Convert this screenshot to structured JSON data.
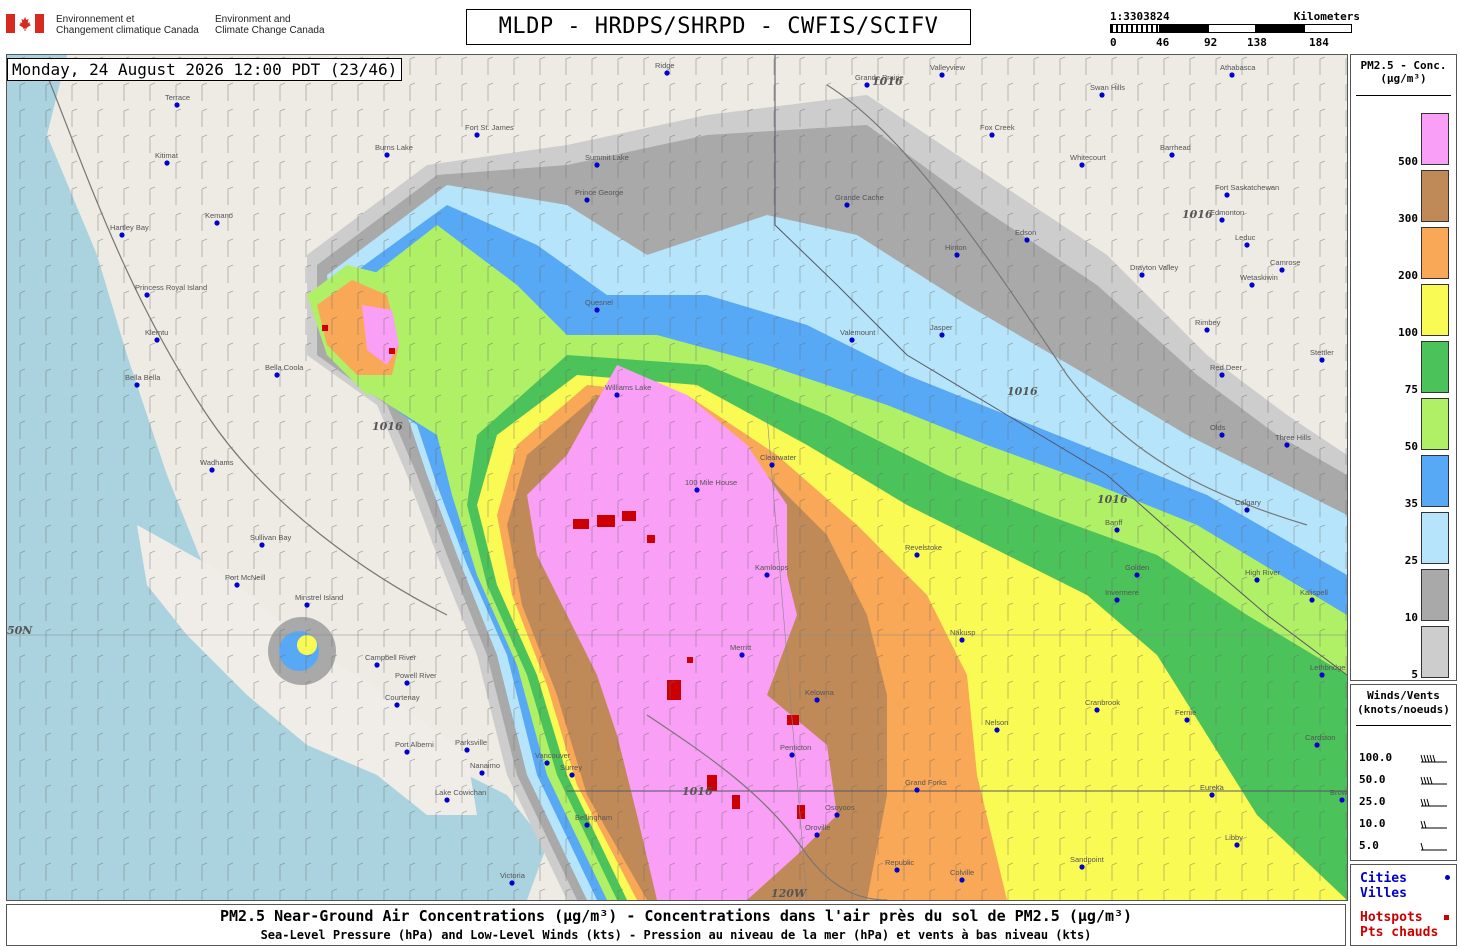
{
  "header": {
    "dept_fr": [
      "Environnement et",
      "Changement climatique Canada"
    ],
    "dept_en": [
      "Environment and",
      "Climate Change Canada"
    ],
    "title": "MLDP - HRDPS/SHRPD - CWFIS/SCIFV"
  },
  "scale": {
    "ratio": "1:3303824",
    "unit": "Kilometers",
    "ticks": [
      "0",
      "46",
      "92",
      "138",
      "184"
    ]
  },
  "map": {
    "time_label": "Monday, 24 August 2026 12:00 PDT (23/46)",
    "isobar_label": "1016",
    "lat_label": "50N",
    "lon_label": "120W",
    "cities": [
      {
        "name": "Terrace"
      },
      {
        "name": "Kitimat"
      },
      {
        "name": "Hartley Bay"
      },
      {
        "name": "Kemano"
      },
      {
        "name": "Princess Royal Island"
      },
      {
        "name": "Klemtu"
      },
      {
        "name": "Bella Bella"
      },
      {
        "name": "Bella Coola"
      },
      {
        "name": "Wadhams"
      },
      {
        "name": "Sullivan Bay"
      },
      {
        "name": "Port McNeill"
      },
      {
        "name": "Minstrel Island"
      },
      {
        "name": "Campbell River"
      },
      {
        "name": "Powell River"
      },
      {
        "name": "Courtenay"
      },
      {
        "name": "Port Alberni"
      },
      {
        "name": "Parksville"
      },
      {
        "name": "Nanaimo"
      },
      {
        "name": "Lake Cowichan"
      },
      {
        "name": "Victoria"
      },
      {
        "name": "Vancouver"
      },
      {
        "name": "Surrey"
      },
      {
        "name": "Bellingham"
      },
      {
        "name": "Fort St. James"
      },
      {
        "name": "Burns Lake"
      },
      {
        "name": "Summit Lake"
      },
      {
        "name": "Prince George"
      },
      {
        "name": "Quesnel"
      },
      {
        "name": "Williams Lake"
      },
      {
        "name": "100 Mile House"
      },
      {
        "name": "Clearwater"
      },
      {
        "name": "Kamloops"
      },
      {
        "name": "Merritt"
      },
      {
        "name": "Kelowna"
      },
      {
        "name": "Penticton"
      },
      {
        "name": "Osoyoos"
      },
      {
        "name": "Grand Forks"
      },
      {
        "name": "Revelstoke"
      },
      {
        "name": "Nakusp"
      },
      {
        "name": "Nelson"
      },
      {
        "name": "Cranbrook"
      },
      {
        "name": "Fernie"
      },
      {
        "name": "Invermere"
      },
      {
        "name": "Golden"
      },
      {
        "name": "Banff"
      },
      {
        "name": "Calgary"
      },
      {
        "name": "High River"
      },
      {
        "name": "Red Deer"
      },
      {
        "name": "Edmonton"
      },
      {
        "name": "Leduc"
      },
      {
        "name": "Wetaskiwin"
      },
      {
        "name": "Camrose"
      },
      {
        "name": "Hinton"
      },
      {
        "name": "Edson"
      },
      {
        "name": "Jasper"
      },
      {
        "name": "Valemount"
      },
      {
        "name": "Grande Cache"
      },
      {
        "name": "Grande Prairie"
      },
      {
        "name": "Fox Creek"
      },
      {
        "name": "Whitecourt"
      },
      {
        "name": "Barrhead"
      },
      {
        "name": "Swan Hills"
      },
      {
        "name": "Drayton Valley"
      },
      {
        "name": "Rimbey"
      },
      {
        "name": "Olds"
      },
      {
        "name": "Three Hills"
      },
      {
        "name": "Stettler"
      },
      {
        "name": "Fort Saskatchewan"
      },
      {
        "name": "Athabasca"
      },
      {
        "name": "Valleyview"
      },
      {
        "name": "Ridge"
      },
      {
        "name": "Lethbridge"
      },
      {
        "name": "Cardston"
      },
      {
        "name": "Eureka"
      },
      {
        "name": "Libby"
      },
      {
        "name": "Sandpoint"
      },
      {
        "name": "Colville"
      },
      {
        "name": "Republic"
      },
      {
        "name": "Oroville"
      },
      {
        "name": "Kalispell"
      },
      {
        "name": "Browning"
      }
    ]
  },
  "legend": {
    "title_lines": [
      "PM2.5 - Conc.",
      "(µg/m³)"
    ],
    "levels": [
      {
        "label": "500",
        "color": "#f99ff5"
      },
      {
        "label": "300",
        "color": "#c08a58"
      },
      {
        "label": "200",
        "color": "#f9a857"
      },
      {
        "label": "100",
        "color": "#fafa55"
      },
      {
        "label": "75",
        "color": "#4cc35a"
      },
      {
        "label": "50",
        "color": "#aff066"
      },
      {
        "label": "35",
        "color": "#58a9f5"
      },
      {
        "label": "25",
        "color": "#b6e5fb"
      },
      {
        "label": "10",
        "color": "#a9a9a9"
      },
      {
        "label": "5",
        "color": "#cdcdcd"
      }
    ]
  },
  "winds": {
    "title_lines": [
      "Winds/Vents",
      "(knots/noeuds)"
    ],
    "rows": [
      "100.0",
      "50.0",
      "25.0",
      "10.0",
      "5.0"
    ]
  },
  "key": {
    "cities_en": "Cities",
    "cities_fr": "Villes",
    "hotspots_en": "Hotspots",
    "hotspots_fr": "Pts chauds",
    "city_color": "#0000cc",
    "hotspot_color": "#cc0000"
  },
  "caption": {
    "line1": "PM2.5 Near-Ground Air Concentrations (µg/m³) - Concentrations dans l'air près du sol de PM2.5 (µg/m³)",
    "line2": "Sea-Level Pressure (hPa) and Low-Level Winds (kts) - Pression au niveau de la mer (hPa) et vents à bas niveau (kts)"
  }
}
